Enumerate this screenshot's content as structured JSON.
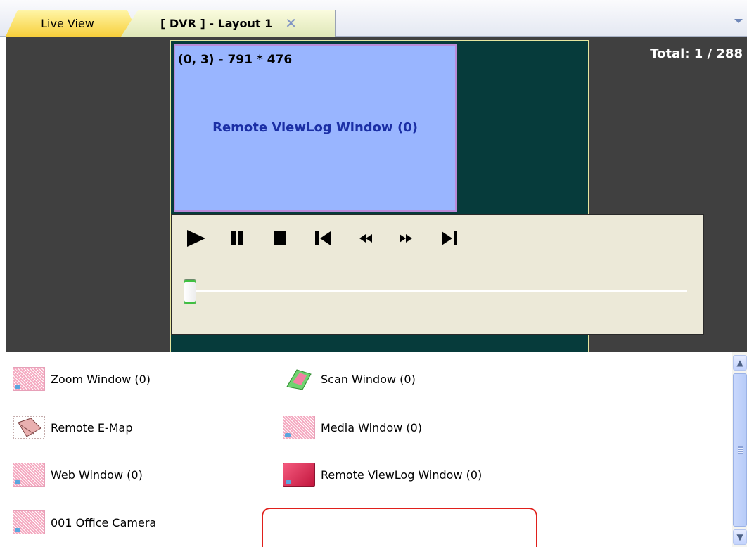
{
  "tabs": [
    {
      "label": "Live View"
    },
    {
      "label": "[ DVR ] - Layout 1",
      "close_icon": "close-icon"
    }
  ],
  "canvas": {
    "total_label": "Total: 1 / 288",
    "tile": {
      "coords": "(0, 3) - 791 * 476",
      "title": "Remote ViewLog Window (0)"
    }
  },
  "playback": {
    "buttons": [
      "play-icon",
      "pause-icon",
      "stop-icon",
      "skip-to-start-icon",
      "rewind-icon",
      "fast-forward-icon",
      "skip-to-end-icon"
    ],
    "slider_position": 0
  },
  "palette": {
    "items": [
      {
        "label": "Zoom Window (0)",
        "icon": "zoom-window-icon"
      },
      {
        "label": "Scan Window (0)",
        "icon": "scan-window-icon"
      },
      {
        "label": "Remote E-Map",
        "icon": "emap-icon"
      },
      {
        "label": "Media Window (0)",
        "icon": "media-window-icon"
      },
      {
        "label": "Web Window (0)",
        "icon": "web-window-icon"
      },
      {
        "label": "Remote ViewLog Window (0)",
        "icon": "viewlog-window-icon",
        "highlighted": true
      },
      {
        "label": "001 Office Camera",
        "icon": "camera-window-icon"
      }
    ]
  },
  "colors": {
    "canvas_bg": "#404040",
    "tile_bg": "#99b5ff",
    "tile_title": "#1b2fa6",
    "highlight": "#e0201c"
  }
}
